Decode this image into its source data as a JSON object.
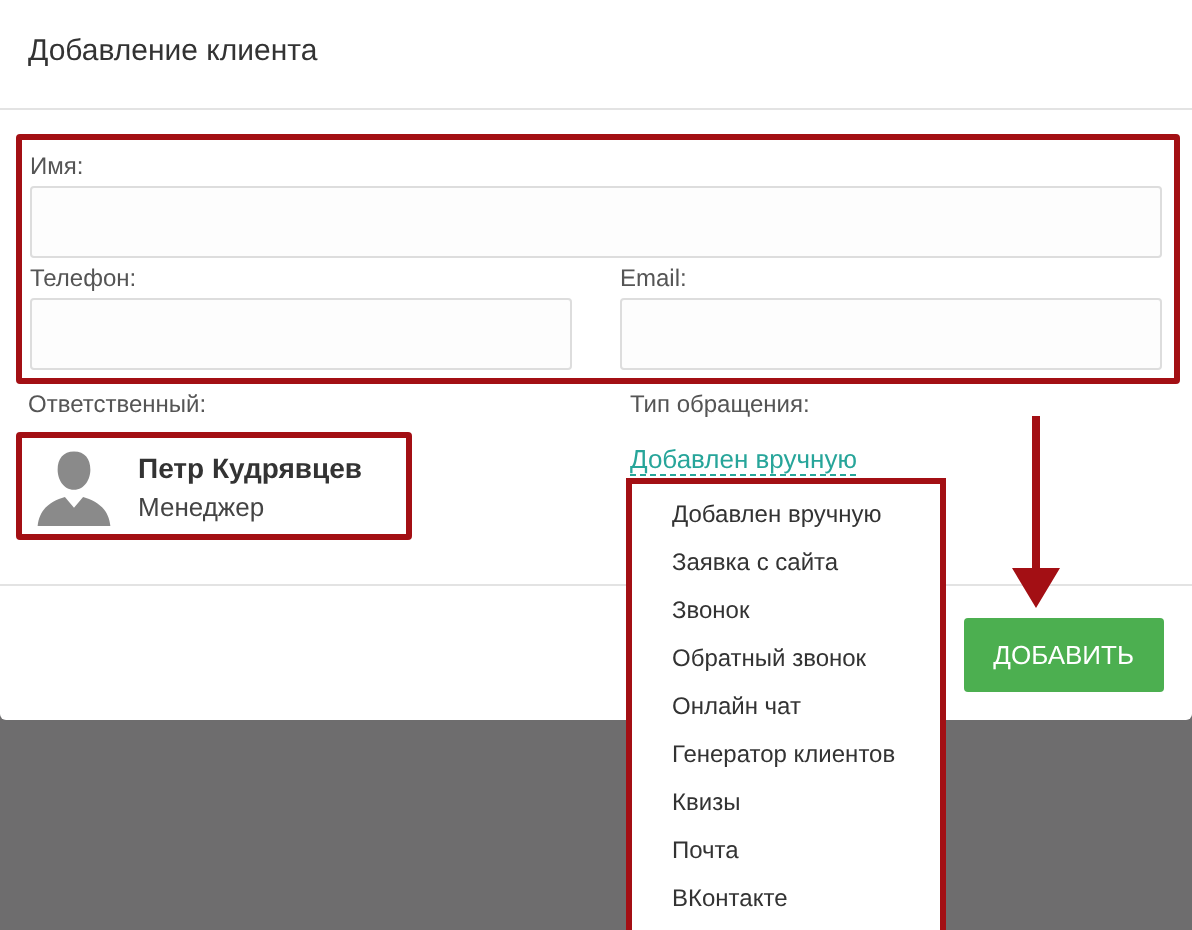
{
  "dialog": {
    "title": "Добавление клиента"
  },
  "fields": [
    {
      "label": "Имя:"
    },
    {
      "label": "Телефон:"
    },
    {
      "label": "Email:"
    }
  ],
  "responsible": {
    "label": "Ответственный:",
    "name": "Петр Кудрявцев",
    "role": "Менеджер"
  },
  "request_type": {
    "label": "Тип обращения:",
    "value": "Добавлен вручную",
    "options": [
      {
        "label": "Добавлен вручную"
      },
      {
        "label": "Заявка с сайта"
      },
      {
        "label": "Звонок"
      },
      {
        "label": "Обратный звонок"
      },
      {
        "label": "Онлайн чат"
      },
      {
        "label": "Генератор клиентов"
      },
      {
        "label": "Квизы"
      },
      {
        "label": "Почта"
      },
      {
        "label": "ВКонтакте"
      }
    ]
  },
  "buttons": [
    {
      "label": "ДОБАВИТЬ"
    }
  ]
}
